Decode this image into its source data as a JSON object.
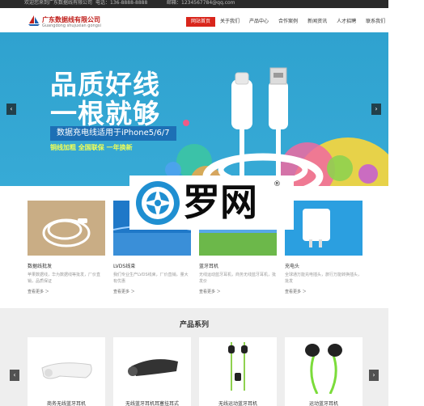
{
  "topbar": {
    "left_text": "欢迎您来到广东数据线有限公司",
    "middle_text": "电话：136-8888-8888",
    "right_text": "邮箱：1234567784@qq.com"
  },
  "header": {
    "logo_cn": "广东数据线有限公司",
    "logo_en": "Guangdong shujuxian gongsi"
  },
  "nav": {
    "items": [
      "网站首页",
      "关于我们",
      "产品中心",
      "合作案例",
      "新闻资讯",
      "人才招聘",
      "联系我们"
    ],
    "active_index": 0
  },
  "banner": {
    "headline_1": "品质好线",
    "headline_2": "一根就够",
    "ribbon": "数据充电线适用于iPhone5/6/7",
    "subline": "铜线加粗  全国联保  一年换新",
    "prev_arrow": "‹",
    "next_arrow": "›"
  },
  "products": [
    {
      "title": "数据线批发",
      "desc": "苹果数据线，华为数据线等批发，厂价直销，品质保证",
      "more": "查看更多 ＞"
    },
    {
      "title": "LVDS线束",
      "desc": "我们专业生产LVDS线束，厂价直销，量大有优惠",
      "more": "查看更多 ＞"
    },
    {
      "title": "蓝牙耳机",
      "desc": "无线运动蓝牙耳机，商务无线蓝牙耳机，批发价",
      "more": "查看更多 ＞"
    },
    {
      "title": "充电头",
      "desc": "全球通万能充电插头，旅行万能转换插头，批发",
      "more": "查看更多 ＞"
    }
  ],
  "watermark": {
    "text": "罗网",
    "reg": "®"
  },
  "series": {
    "title": "产品系列",
    "items": [
      "商务无线蓝牙耳机",
      "无线蓝牙耳机耳塞挂耳式",
      "无线运动蓝牙耳机",
      "运动蓝牙耳机"
    ],
    "prev_arrow": "‹",
    "next_arrow": "›"
  },
  "colors": {
    "accent_red": "#d9261c",
    "banner_blue": "#37aad6",
    "topbar_dark": "#2a2a2a",
    "series_bg": "#eeeeee"
  }
}
